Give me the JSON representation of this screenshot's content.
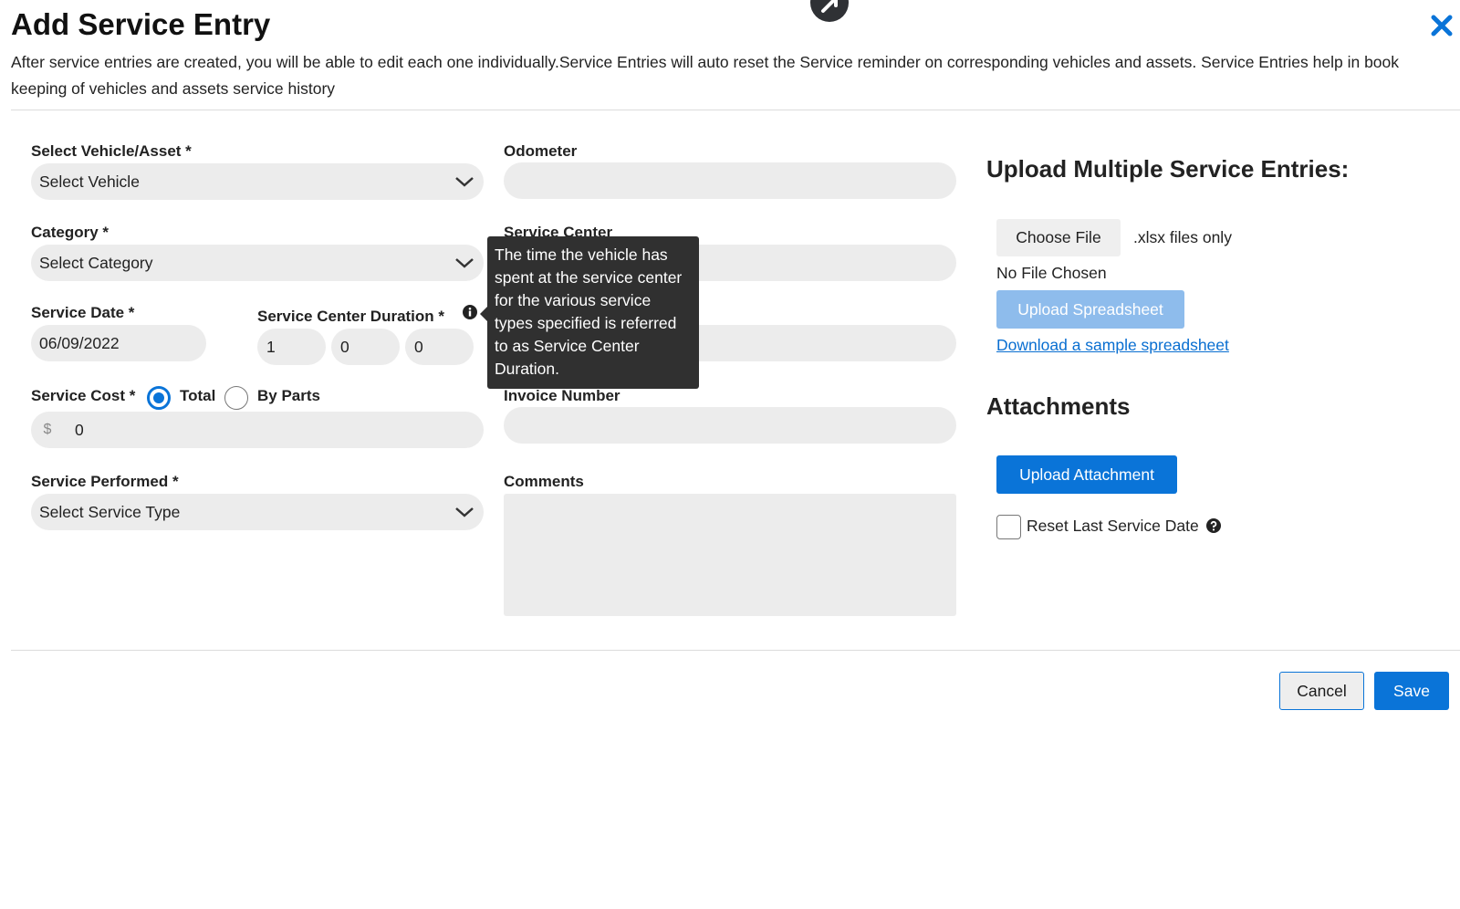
{
  "dialog": {
    "title": "Add Service Entry",
    "description": "After service entries are created, you will be able to edit each one individually.Service Entries will auto reset the Service reminder on corresponding vehicles and assets. Service Entries help in book keeping of vehicles and assets service history"
  },
  "form": {
    "vehicle": {
      "label": "Select Vehicle/Asset *",
      "value": "Select Vehicle"
    },
    "category": {
      "label": "Category *",
      "value": "Select Category"
    },
    "service_date": {
      "label": "Service Date *",
      "value": "06/09/2022"
    },
    "duration": {
      "label": "Service Center Duration *",
      "values": [
        "1",
        "0",
        "0"
      ]
    },
    "service_cost": {
      "label": "Service Cost *",
      "option_total": "Total",
      "option_parts": "By Parts",
      "selected": "Total",
      "currency": "$",
      "value": "0"
    },
    "service_performed": {
      "label": "Service Performed *",
      "value": "Select Service Type"
    },
    "odometer": {
      "label": "Odometer",
      "value": ""
    },
    "service_center": {
      "label": "Service Center",
      "value": ""
    },
    "invoice_number": {
      "label": "Invoice Number",
      "value": ""
    },
    "comments": {
      "label": "Comments",
      "value": ""
    }
  },
  "tooltip": {
    "text": "The time the vehicle has spent at the service center for the various service types specified is referred to as Service Center Duration."
  },
  "upload": {
    "heading": "Upload Multiple Service Entries:",
    "choose_file": "Choose File",
    "file_hint": ".xlsx files only",
    "file_status": "No File Chosen",
    "upload_button": "Upload Spreadsheet",
    "sample_link": "Download a sample spreadsheet"
  },
  "attachments": {
    "heading": "Attachments",
    "upload_button": "Upload Attachment",
    "reset_label": "Reset Last Service Date",
    "reset_checked": false
  },
  "footer": {
    "cancel": "Cancel",
    "save": "Save"
  },
  "colors": {
    "primary": "#0a74d8",
    "primary_disabled": "#8ebcec",
    "field_bg": "#ececec",
    "tooltip_bg": "#303030"
  }
}
